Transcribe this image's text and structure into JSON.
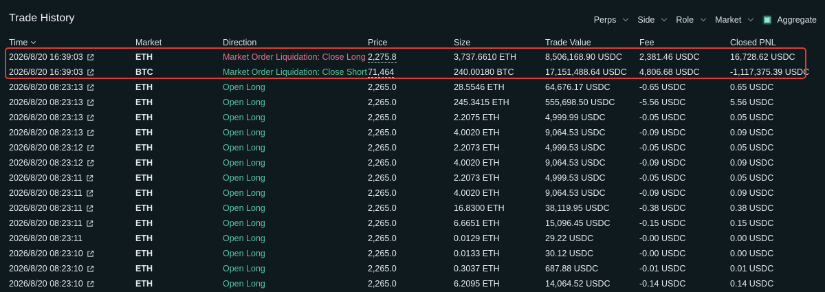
{
  "header": {
    "title": "Trade History",
    "filters": [
      "Perps",
      "Side",
      "Role",
      "Market"
    ],
    "aggregate_label": "Aggregate"
  },
  "columns": [
    "Time",
    "Market",
    "Direction",
    "Price",
    "Size",
    "Trade Value",
    "Fee",
    "Closed PNL"
  ],
  "colors": {
    "long_liquidation": "#e0748a",
    "short_liquidation": "#52c49e",
    "open_long": "#52c49e",
    "highlight_border": "#e03b2c",
    "background": "#0f1a1f"
  },
  "rows": [
    {
      "time": "2026/8/20 16:39:03",
      "link": true,
      "market": "ETH",
      "direction": "Market Order Liquidation: Close Long",
      "dir_type": "long_liquidation",
      "price": "2,275.8",
      "price_dotted": true,
      "size": "3,737.6610 ETH",
      "value": "8,506,168.90 USDC",
      "fee": "2,381.46 USDC",
      "pnl": "16,728.62 USDC"
    },
    {
      "time": "2026/8/20 16:39:03",
      "link": true,
      "market": "BTC",
      "direction": "Market Order Liquidation: Close Short",
      "dir_type": "short_liquidation",
      "price": "71,464",
      "price_dotted": true,
      "size": "240.00180 BTC",
      "value": "17,151,488.64 USDC",
      "fee": "4,806.68 USDC",
      "pnl": "-1,117,375.39 USDC"
    },
    {
      "time": "2026/8/20 08:23:13",
      "link": true,
      "market": "ETH",
      "direction": "Open Long",
      "dir_type": "open_long",
      "price": "2,265.0",
      "size": "28.5546 ETH",
      "value": "64,676.17 USDC",
      "fee": "-0.65 USDC",
      "pnl": "0.65 USDC"
    },
    {
      "time": "2026/8/20 08:23:13",
      "link": true,
      "market": "ETH",
      "direction": "Open Long",
      "dir_type": "open_long",
      "price": "2,265.0",
      "size": "245.3415 ETH",
      "value": "555,698.50 USDC",
      "fee": "-5.56 USDC",
      "pnl": "5.56 USDC"
    },
    {
      "time": "2026/8/20 08:23:13",
      "link": true,
      "market": "ETH",
      "direction": "Open Long",
      "dir_type": "open_long",
      "price": "2,265.0",
      "size": "2.2075 ETH",
      "value": "4,999.99 USDC",
      "fee": "-0.05 USDC",
      "pnl": "0.05 USDC"
    },
    {
      "time": "2026/8/20 08:23:13",
      "link": true,
      "market": "ETH",
      "direction": "Open Long",
      "dir_type": "open_long",
      "price": "2,265.0",
      "size": "4.0020 ETH",
      "value": "9,064.53 USDC",
      "fee": "-0.09 USDC",
      "pnl": "0.09 USDC"
    },
    {
      "time": "2026/8/20 08:23:12",
      "link": true,
      "market": "ETH",
      "direction": "Open Long",
      "dir_type": "open_long",
      "price": "2,265.0",
      "size": "2.2073 ETH",
      "value": "4,999.53 USDC",
      "fee": "-0.05 USDC",
      "pnl": "0.05 USDC"
    },
    {
      "time": "2026/8/20 08:23:12",
      "link": true,
      "market": "ETH",
      "direction": "Open Long",
      "dir_type": "open_long",
      "price": "2,265.0",
      "size": "4.0020 ETH",
      "value": "9,064.53 USDC",
      "fee": "-0.09 USDC",
      "pnl": "0.09 USDC"
    },
    {
      "time": "2026/8/20 08:23:11",
      "link": true,
      "market": "ETH",
      "direction": "Open Long",
      "dir_type": "open_long",
      "price": "2,265.0",
      "size": "2.2073 ETH",
      "value": "4,999.53 USDC",
      "fee": "-0.05 USDC",
      "pnl": "0.05 USDC"
    },
    {
      "time": "2026/8/20 08:23:11",
      "link": true,
      "market": "ETH",
      "direction": "Open Long",
      "dir_type": "open_long",
      "price": "2,265.0",
      "size": "4.0020 ETH",
      "value": "9,064.53 USDC",
      "fee": "-0.09 USDC",
      "pnl": "0.09 USDC"
    },
    {
      "time": "2026/8/20 08:23:11",
      "link": true,
      "market": "ETH",
      "direction": "Open Long",
      "dir_type": "open_long",
      "price": "2,265.0",
      "size": "16.8300 ETH",
      "value": "38,119.95 USDC",
      "fee": "-0.38 USDC",
      "pnl": "0.38 USDC"
    },
    {
      "time": "2026/8/20 08:23:11",
      "link": true,
      "market": "ETH",
      "direction": "Open Long",
      "dir_type": "open_long",
      "price": "2,265.0",
      "size": "6.6651 ETH",
      "value": "15,096.45 USDC",
      "fee": "-0.15 USDC",
      "pnl": "0.15 USDC"
    },
    {
      "time": "2026/8/20 08:23:11",
      "link": false,
      "market": "ETH",
      "direction": "Open Long",
      "dir_type": "open_long",
      "price": "2,265.0",
      "size": "0.0129 ETH",
      "value": "29.22 USDC",
      "fee": "-0.00 USDC",
      "pnl": "0.00 USDC"
    },
    {
      "time": "2026/8/20 08:23:10",
      "link": true,
      "market": "ETH",
      "direction": "Open Long",
      "dir_type": "open_long",
      "price": "2,265.0",
      "size": "0.0133 ETH",
      "value": "30.12 USDC",
      "fee": "-0.00 USDC",
      "pnl": "0.00 USDC"
    },
    {
      "time": "2026/8/20 08:23:10",
      "link": true,
      "market": "ETH",
      "direction": "Open Long",
      "dir_type": "open_long",
      "price": "2,265.0",
      "size": "0.3037 ETH",
      "value": "687.88 USDC",
      "fee": "-0.01 USDC",
      "pnl": "0.01 USDC"
    },
    {
      "time": "2026/8/20 08:23:10",
      "link": true,
      "market": "ETH",
      "direction": "Open Long",
      "dir_type": "open_long",
      "price": "2,265.0",
      "size": "6.2095 ETH",
      "value": "14,064.52 USDC",
      "fee": "-0.14 USDC",
      "pnl": "0.14 USDC"
    }
  ]
}
